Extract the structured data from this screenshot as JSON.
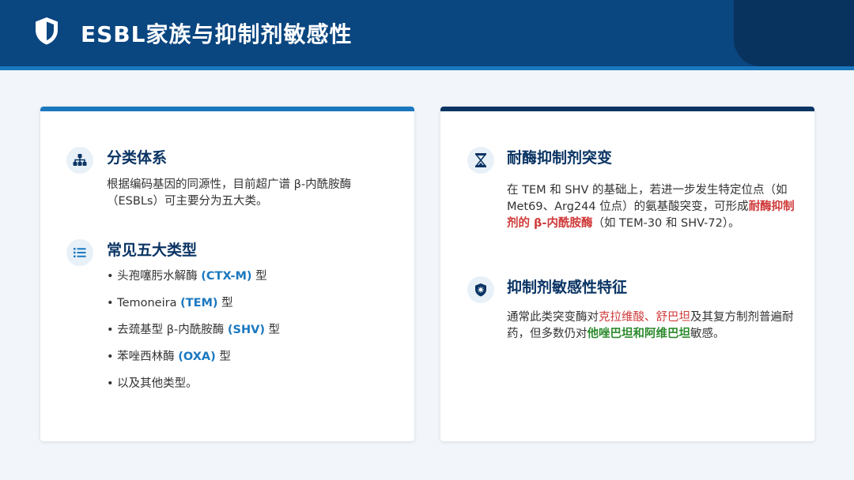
{
  "header": {
    "title": "ESBL家族与抑制剂敏感性",
    "icon": "shield-icon"
  },
  "left_card": {
    "classification": {
      "title": "分类体系",
      "icon": "hierarchy-icon",
      "text": "根据编码基因的同源性，目前超广谱 β-内酰胺酶（ESBLs）可主要分为五大类。"
    },
    "types": {
      "title": "常见五大类型",
      "icon": "list-icon",
      "items": [
        {
          "bullet": "•",
          "prefix": "头孢噻肟水解酶 ",
          "highlight": "(CTX-M)",
          "suffix": " 型"
        },
        {
          "bullet": "•",
          "prefix": "Temoneira ",
          "highlight": "(TEM)",
          "suffix": " 型"
        },
        {
          "bullet": "•",
          "prefix": "去巯基型 β-内酰胺酶 ",
          "highlight": "(SHV)",
          "suffix": " 型"
        },
        {
          "bullet": "•",
          "prefix": "苯唑西林酶 ",
          "highlight": "(OXA)",
          "suffix": " 型"
        },
        {
          "bullet": "•",
          "prefix": "以及其他类型。",
          "highlight": "",
          "suffix": ""
        }
      ]
    }
  },
  "right_card": {
    "mutation": {
      "title": "耐酶抑制剂突变",
      "icon": "hourglass-icon",
      "text_before": "在 TEM 和 SHV 的基础上，若进一步发生特定位点（如 Met69、Arg244 位点）的氨基酸突变，可形成",
      "text_highlight": "耐酶抑制剂的 β-内酰胺酶",
      "text_after": "（如 TEM-30 和 SHV-72）。"
    },
    "sensitivity": {
      "title": "抑制剂敏感性特征",
      "icon": "shield-virus-icon",
      "text_before": "通常此类突变酶对",
      "text_red": "克拉维酸、舒巴坦",
      "text_middle": "及其复方制剂普遍耐药，但多数仍对",
      "text_green": "他唑巴坦和阿维巴坦",
      "text_after": "敏感。"
    }
  },
  "colors": {
    "header_bg": "#0a4680",
    "header_accent": "#08335e",
    "accent_blue": "#1b78bf",
    "title_navy": "#0a3464",
    "highlight_red": "#d03a3a",
    "highlight_green": "#2e8b2e",
    "page_bg": "#f2f6fa"
  }
}
